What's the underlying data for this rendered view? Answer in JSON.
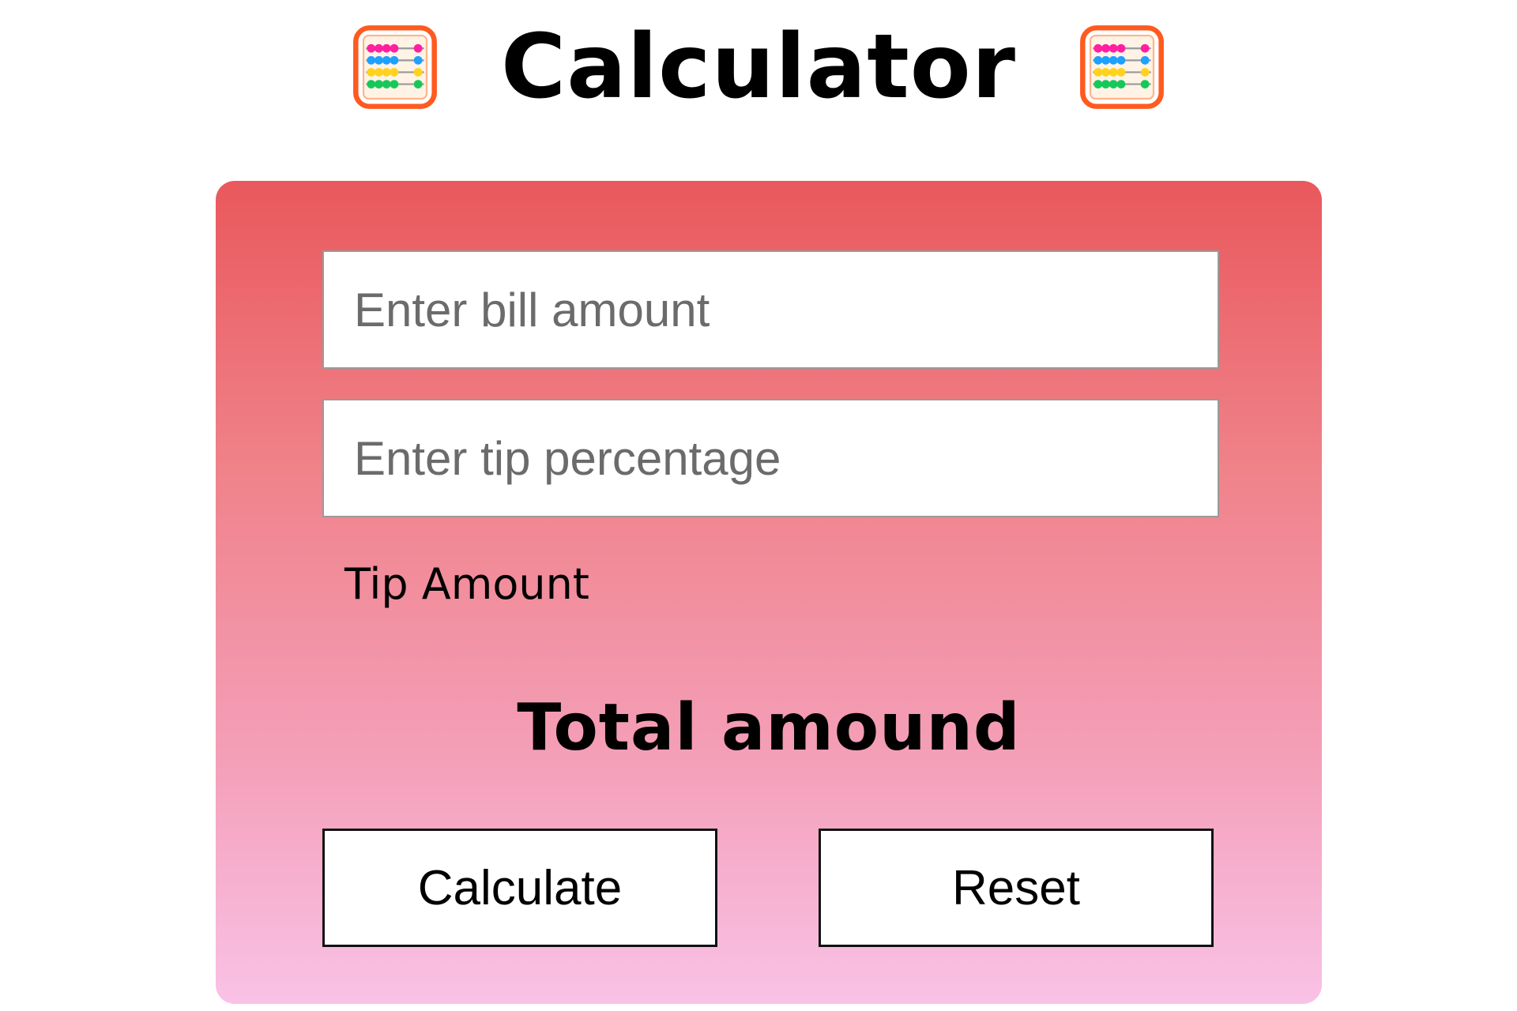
{
  "header": {
    "title": "Calculator",
    "left_icon": "abacus-icon",
    "right_icon": "abacus-icon"
  },
  "form": {
    "bill_placeholder": "Enter bill amount",
    "tip_placeholder": "Enter tip percentage",
    "tip_amount_label": "Tip Amount",
    "total_label": "Total amound",
    "calculate_label": "Calculate",
    "reset_label": "Reset"
  },
  "colors": {
    "card_gradient_top": "#e9585c",
    "card_gradient_bottom": "#f9c2e6",
    "abacus_frame": "#ff5a1f"
  }
}
